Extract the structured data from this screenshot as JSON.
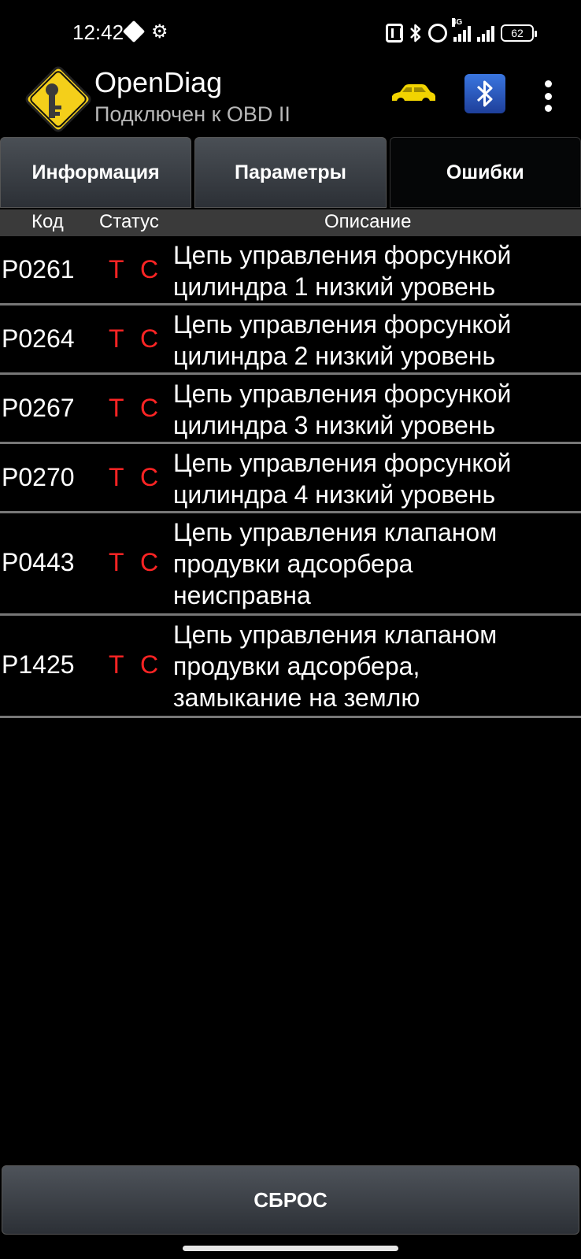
{
  "status_bar": {
    "time": "12:42",
    "network_label": "4G",
    "battery": "62",
    "icons": [
      "diamond-icon",
      "gear-icon",
      "nfc-icon",
      "bluetooth-icon",
      "alarm-icon",
      "signal-icon",
      "battery-icon"
    ]
  },
  "app": {
    "title": "OpenDiag",
    "subtitle": "Подключен к OBD II",
    "icons": [
      "car-icon",
      "bluetooth-adapter-icon",
      "overflow-menu-icon"
    ],
    "colors": {
      "car": "#f2d400",
      "logo": "#f4cf1a",
      "error_status": "#ff2424"
    }
  },
  "tabs": [
    {
      "label": "Информация"
    },
    {
      "label": "Параметры"
    },
    {
      "label": "Ошибки",
      "active": true
    }
  ],
  "columns": {
    "code": "Код",
    "status": "Статус",
    "description": "Описание"
  },
  "errors": [
    {
      "code": "P0261",
      "status_t": "T",
      "status_c": "C",
      "desc_lines": [
        "Цепь управления форсункой",
        "цилиндра 1 низкий уровень"
      ]
    },
    {
      "code": "P0264",
      "status_t": "T",
      "status_c": "C",
      "desc_lines": [
        "Цепь управления форсункой",
        "цилиндра 2 низкий уровень"
      ]
    },
    {
      "code": "P0267",
      "status_t": "T",
      "status_c": "C",
      "desc_lines": [
        "Цепь управления форсункой",
        "цилиндра 3 низкий уровень"
      ]
    },
    {
      "code": "P0270",
      "status_t": "T",
      "status_c": "C",
      "desc_lines": [
        "Цепь управления форсункой",
        "цилиндра 4 низкий уровень"
      ]
    },
    {
      "code": "P0443",
      "status_t": "T",
      "status_c": "C",
      "desc_lines": [
        "Цепь управления клапаном",
        "продувки адсорбера",
        "неисправна"
      ]
    },
    {
      "code": "P1425",
      "status_t": "T",
      "status_c": "C",
      "desc_lines": [
        "Цепь управления клапаном",
        "продувки адсорбера,",
        "замыкание на землю"
      ]
    }
  ],
  "reset_label": "СБРОС"
}
